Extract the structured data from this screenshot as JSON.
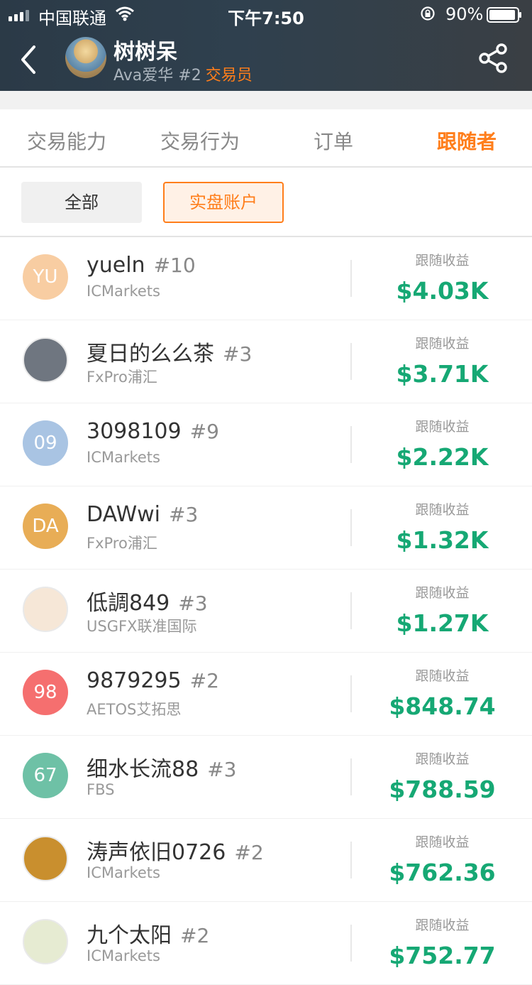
{
  "status_bar": {
    "carrier": "中国联通",
    "time": "下午7:50",
    "battery": "90%"
  },
  "header": {
    "name": "树树呆",
    "sub": "Ava爱华 #2",
    "role": "交易员",
    "back_icon": "chevron-left-icon",
    "share_icon": "share-icon"
  },
  "tabs": [
    {
      "label": "交易能力",
      "active": false
    },
    {
      "label": "交易行为",
      "active": false
    },
    {
      "label": "订单",
      "active": false
    },
    {
      "label": "跟随者",
      "active": true
    }
  ],
  "filters": {
    "all": "全部",
    "real": "实盘账户"
  },
  "colors": {
    "accent": "#ff7e1b",
    "profit": "#16a874",
    "header_bg": "#2f404e"
  },
  "followers": [
    {
      "avatar_text": "YU",
      "avatar_color": "#f8cda2",
      "name": "yueln",
      "rank": "#10",
      "broker": "ICMarkets",
      "earn_label": "跟随收益",
      "earn": "$4.03K"
    },
    {
      "avatar_text": "",
      "avatar_color": "#6f7680",
      "name": "夏日的么么茶",
      "rank": "#3",
      "broker": "FxPro浦汇",
      "earn_label": "跟随收益",
      "earn": "$3.71K"
    },
    {
      "avatar_text": "09",
      "avatar_color": "#a9c4e3",
      "name": "3098109",
      "rank": "#9",
      "broker": "ICMarkets",
      "earn_label": "跟随收益",
      "earn": "$2.22K"
    },
    {
      "avatar_text": "DA",
      "avatar_color": "#e8ad56",
      "name": "DAWwi",
      "rank": "#3",
      "broker": "FxPro浦汇",
      "earn_label": "跟随收益",
      "earn": "$1.32K"
    },
    {
      "avatar_text": "",
      "avatar_color": "#f6e7d7",
      "name": "低調849",
      "rank": "#3",
      "broker": "USGFX联准国际",
      "earn_label": "跟随收益",
      "earn": "$1.27K"
    },
    {
      "avatar_text": "98",
      "avatar_color": "#f56f6f",
      "name": "9879295",
      "rank": "#2",
      "broker": "AETOS艾拓思",
      "earn_label": "跟随收益",
      "earn": "$848.74"
    },
    {
      "avatar_text": "67",
      "avatar_color": "#6ec1a6",
      "name": "细水长流88",
      "rank": "#3",
      "broker": "FBS",
      "earn_label": "跟随收益",
      "earn": "$788.59"
    },
    {
      "avatar_text": "",
      "avatar_color": "#c98f2e",
      "name": "涛声依旧0726",
      "rank": "#2",
      "broker": "ICMarkets",
      "earn_label": "跟随收益",
      "earn": "$762.36"
    },
    {
      "avatar_text": "",
      "avatar_color": "#e6ebd2",
      "name": "九个太阳",
      "rank": "#2",
      "broker": "ICMarkets",
      "earn_label": "跟随收益",
      "earn": "$752.77"
    }
  ]
}
